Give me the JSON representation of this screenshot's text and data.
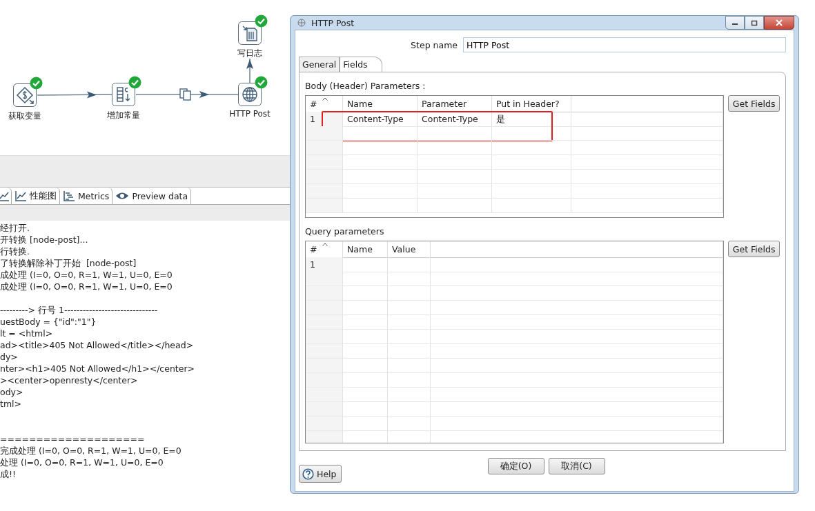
{
  "canvas": {
    "steps": [
      {
        "label": "写日志",
        "kind": "log",
        "done": true
      },
      {
        "label": "获取变量",
        "kind": "variable",
        "done": true
      },
      {
        "label": "增加常量",
        "kind": "constant",
        "done": true
      },
      {
        "label": "HTTP Post",
        "kind": "http",
        "done": true
      }
    ],
    "hops": [
      {
        "copy": false
      },
      {
        "copy": true
      },
      {
        "copy": false
      }
    ]
  },
  "results_tabs": [
    {
      "kind": "chart-left",
      "selected": false
    },
    {
      "label": "性能图",
      "kind": "chart",
      "selected": false
    },
    {
      "label": "Metrics",
      "kind": "metrics",
      "selected": false
    },
    {
      "label": "Preview data",
      "kind": "preview",
      "selected": false
    }
  ],
  "log_blocks": [
    [
      "经打开.",
      "开转换 [node-post]...",
      "行转换.",
      "了转换解除补丁开始  [node-post]",
      "成处理 (I=0, O=0, R=1, W=1, U=0, E=0",
      "成处理 (I=0, O=0, R=1, W=1, U=0, E=0"
    ],
    [
      "---------> 行号 1------------------------------",
      "uestBody = {\"id\":\"1\"}",
      "lt = <html>",
      "ad><title>405 Not Allowed</title></head>",
      "dy>",
      "nter><h1>405 Not Allowed</h1></center>",
      "><center>openresty</center>",
      "ody>",
      "tml>"
    ],
    [
      "====================",
      "完成处理 (I=0, O=0, R=1, W=1, U=0, E=0",
      "处理 (I=0, O=0, R=1, W=1, U=0, E=0",
      "成!!"
    ]
  ],
  "dialog": {
    "title": "HTTP Post",
    "step_name_label": "Step name",
    "step_name": "HTTP Post",
    "tabs": [
      {
        "label": "General",
        "selected": false
      },
      {
        "label": "Fields",
        "selected": true
      }
    ],
    "body_label": "Body (Header) Parameters :",
    "body_table": {
      "columns": [
        "#",
        "Name",
        "Parameter",
        "Put in Header?"
      ],
      "rows": [
        {
          "cells": [
            "1",
            "Content-Type",
            "Content-Type",
            "是"
          ],
          "highlighted": true
        }
      ]
    },
    "get_fields_1": "Get Fields",
    "query_label": "Query parameters",
    "query_table": {
      "columns": [
        "#",
        "Name",
        "Value"
      ],
      "rows": [
        {
          "cells": [
            "1"
          ]
        }
      ]
    },
    "get_fields_2": "Get Fields",
    "ok": "确定(O)",
    "cancel": "取消(C)",
    "help": "Help"
  }
}
